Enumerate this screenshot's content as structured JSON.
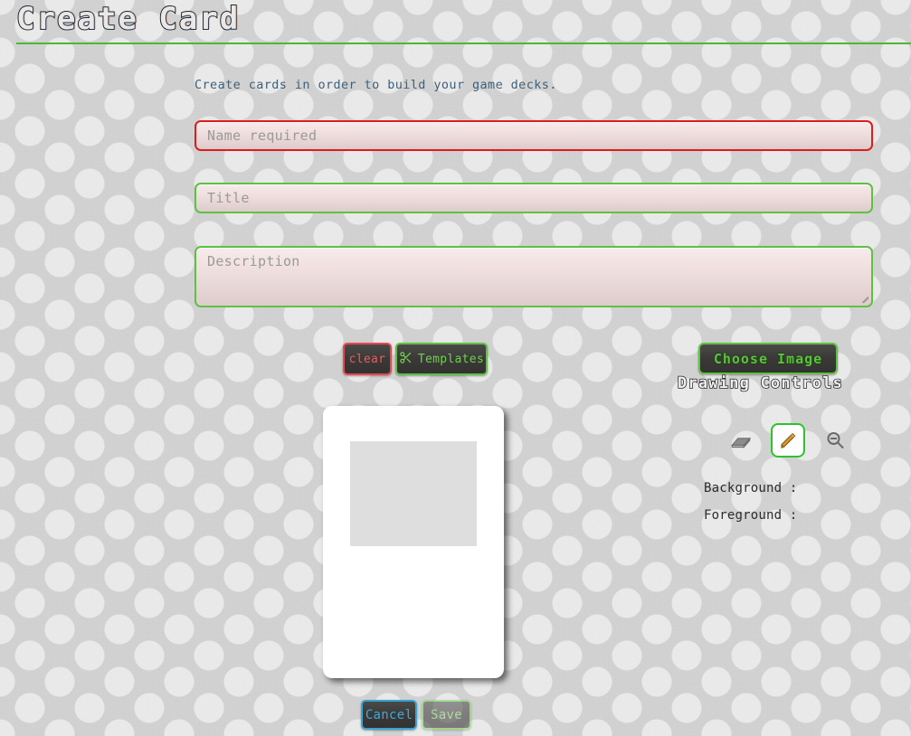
{
  "page": {
    "title": "Create Card",
    "intro": "Create cards in order to build your game decks."
  },
  "form": {
    "name_field": {
      "value": "",
      "placeholder": "Name required",
      "state": "error",
      "border_color": "#e01b1b"
    },
    "title_field": {
      "value": "",
      "placeholder": "Title",
      "state": "ok",
      "border_color": "#5dc142"
    },
    "description_field": {
      "value": "",
      "placeholder": "Description",
      "state": "ok",
      "border_color": "#5dc142"
    }
  },
  "actions": {
    "clear_label": "clear",
    "templates_label": "Templates",
    "templates_icon": "scissors-icon",
    "templates_glyph": "✂",
    "choose_image_label": "Choose Image"
  },
  "drawing_controls": {
    "heading": "Drawing Controls",
    "tools": [
      {
        "name": "eraser-tool",
        "label": "Eraser",
        "selected": false
      },
      {
        "name": "pencil-tool",
        "label": "Pencil",
        "selected": true
      },
      {
        "name": "zoom-out-tool",
        "label": "Zoom Out",
        "selected": false
      }
    ],
    "background": {
      "label": "Background :",
      "color": "#e4e4e4"
    },
    "foreground": {
      "label": "Foreground :",
      "color": "#000000"
    }
  },
  "preview": {
    "card_background": "#ffffff",
    "image_placeholder_color": "#dedede"
  },
  "footer": {
    "cancel_label": "Cancel",
    "save_label": "Save",
    "save_disabled": true
  },
  "theme": {
    "accent_green": "#49b833",
    "error_red": "#e01b1b",
    "info_blue": "#36a5d6",
    "page_bg": "#d5d5d5"
  }
}
